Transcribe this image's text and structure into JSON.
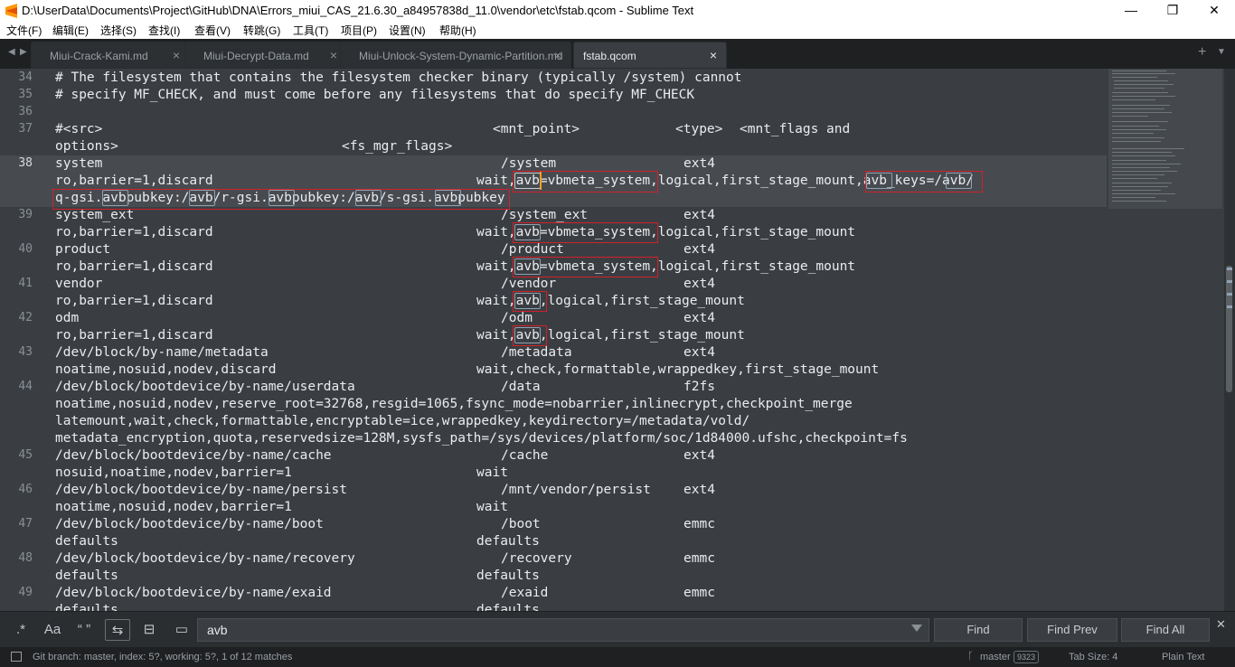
{
  "window": {
    "title": "D:\\UserData\\Documents\\Project\\GitHub\\DNA\\Errors_miui_CAS_21.6.30_a84957838d_11.0\\vendor\\etc\\fstab.qcom - Sublime Text",
    "minimize": "—",
    "maximize": "❐",
    "close": "✕"
  },
  "menu": [
    "文件(F)",
    "编辑(E)",
    "选择(S)",
    "查找(I)",
    "查看(V)",
    "转跳(G)",
    "工具(T)",
    "项目(P)",
    "设置(N)",
    "帮助(H)"
  ],
  "tabs": [
    {
      "label": "Miui-Crack-Kami.md",
      "close": "×"
    },
    {
      "label": "Miui-Decrypt-Data.md",
      "close": "×"
    },
    {
      "label": "Miui-Unlock-System-Dynamic-Partition.md",
      "close": "×"
    },
    {
      "label": "fstab.qcom",
      "close": "×"
    }
  ],
  "tabbar": {
    "prev": "◀",
    "next": "▶",
    "plus": "+",
    "dropdown": "▼"
  },
  "line_numbers": [
    "34",
    "35",
    "36",
    "37",
    "38",
    "39",
    "40",
    "41",
    "42",
    "43",
    "44",
    "45",
    "46",
    "47",
    "48",
    "49"
  ],
  "code_lines": [
    "# The filesystem that contains the filesystem checker binary (typically /system) cannot",
    "# specify MF_CHECK, and must come before any filesystems that do specify MF_CHECK",
    "",
    "#<src>",
    "options>",
    "system",
    "ro,barrier=1,discard",
    "q-gsi.avbpubkey:/avb/r-gsi.avbpubkey:/avb/s-gsi.avbpubkey",
    "system_ext",
    "ro,barrier=1,discard",
    "product",
    "ro,barrier=1,discard",
    "vendor",
    "ro,barrier=1,discard",
    "odm",
    "ro,barrier=1,discard",
    "/dev/block/by-name/metadata",
    "noatime,nosuid,nodev,discard",
    "/dev/block/bootdevice/by-name/userdata",
    "noatime,nosuid,nodev,reserve_root=32768,resgid=1065,fsync_mode=nobarrier,inlinecrypt,checkpoint_merge",
    "latemount,wait,check,formattable,encryptable=ice,wrappedkey,keydirectory=/metadata/vold/",
    "metadata_encryption,quota,reservedsize=128M,sysfs_path=/sys/devices/platform/soc/1d84000.ufshc,checkpoint=fs",
    "/dev/block/bootdevice/by-name/cache",
    "nosuid,noatime,nodev,barrier=1",
    "/dev/block/bootdevice/by-name/persist",
    "noatime,nosuid,nodev,barrier=1",
    "/dev/block/bootdevice/by-name/boot",
    "defaults",
    "/dev/block/bootdevice/by-name/recovery",
    "defaults",
    "/dev/block/bootdevice/by-name/exaid",
    "defaults"
  ],
  "code_columns": {
    "mnt_point_header": "<mnt_point>",
    "type_header": "<type>",
    "flags_header": "<mnt_flags and",
    "fs_mgr_header": "<fs_mgr_flags>",
    "mp_system": "/system",
    "fs_system": "wait,avb=vbmeta_system,logical,first_stage_mount,avb_keys=/avb/",
    "mp_system_ext": "/system_ext",
    "fs_system_ext": "wait,avb=vbmeta_system,logical,first_stage_mount",
    "mp_product": "/product",
    "fs_product": "wait,avb=vbmeta_system,logical,first_stage_mount",
    "mp_vendor": "/vendor",
    "fs_vendor": "wait,avb,logical,first_stage_mount",
    "mp_odm": "/odm",
    "fs_odm": "wait,avb,logical,first_stage_mount",
    "mp_metadata": "/metadata",
    "fs_metadata": "wait,check,formattable,wrappedkey,first_stage_mount",
    "mp_data": "/data",
    "mp_cache": "/cache",
    "fs_cache": "wait",
    "mp_persist": "/mnt/vendor/persist",
    "fs_persist": "wait",
    "mp_boot": "/boot",
    "fs_boot": "defaults",
    "mp_recovery": "/recovery",
    "fs_recovery": "defaults",
    "mp_exaid": "/exaid",
    "fs_exaid": "defaults",
    "t_ext4": "ext4",
    "t_f2fs": "f2fs",
    "t_emmc": "emmc"
  },
  "find": {
    "regex": ".*",
    "case": "Aa",
    "whole_word": "“ ”",
    "wrap": "⇆",
    "in_selection": "⊟",
    "highlight": "▭",
    "query": "avb",
    "find_label": "Find",
    "find_prev_label": "Find Prev",
    "find_all_label": "Find All",
    "close": "✕"
  },
  "status": {
    "text": "Git branch: master, index: 5?, working: 5?, 1 of 12 matches",
    "branch_icon": "ᚴ",
    "branch": "master",
    "badge": "9323",
    "tab_size": "Tab Size: 4",
    "syntax": "Plain Text"
  },
  "colors": {
    "accent_caret": "#f0a020",
    "annotation_red": "#d3202a",
    "match_outline": "#8fa2b2"
  }
}
